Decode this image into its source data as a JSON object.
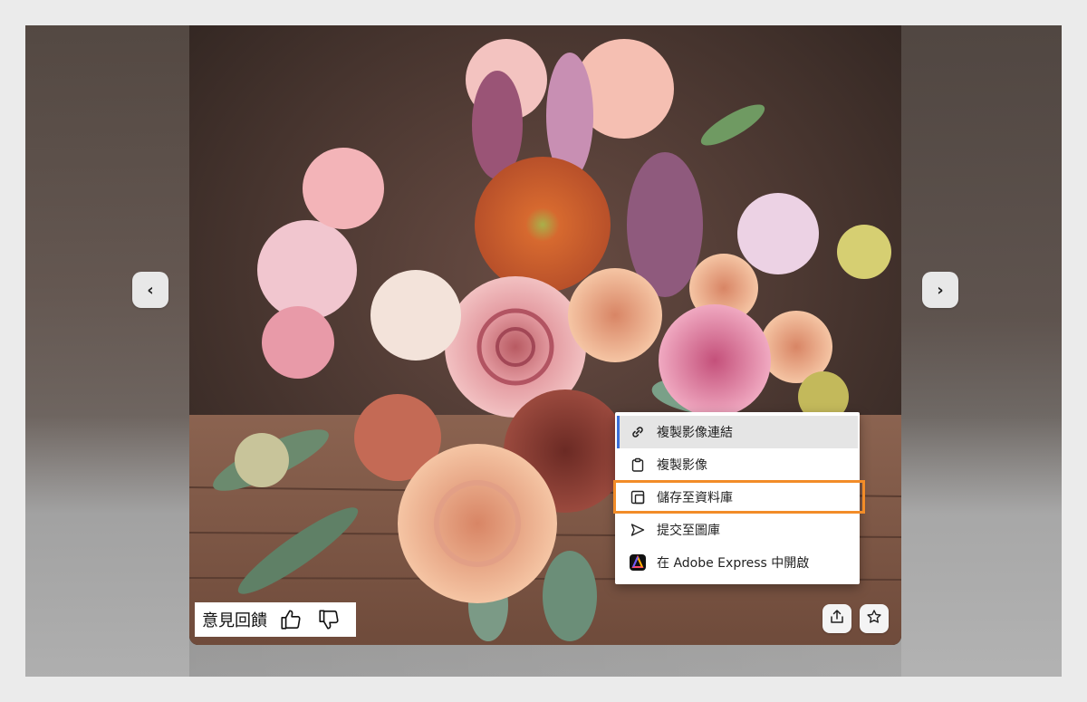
{
  "navigation": {
    "prev_label": "‹",
    "next_label": "›"
  },
  "context_menu": {
    "items": [
      {
        "label": "複製影像連結",
        "icon": "link-icon"
      },
      {
        "label": "複製影像",
        "icon": "clipboard-icon"
      },
      {
        "label": "儲存至資料庫",
        "icon": "library-icon"
      },
      {
        "label": "提交至圖庫",
        "icon": "send-icon"
      },
      {
        "label": "在 Adobe Express 中開啟",
        "icon": "adobe-express-icon"
      }
    ]
  },
  "feedback": {
    "label": "意見回饋"
  },
  "colors": {
    "highlight": "#f28c28",
    "active_bar": "#3b6fd8"
  }
}
